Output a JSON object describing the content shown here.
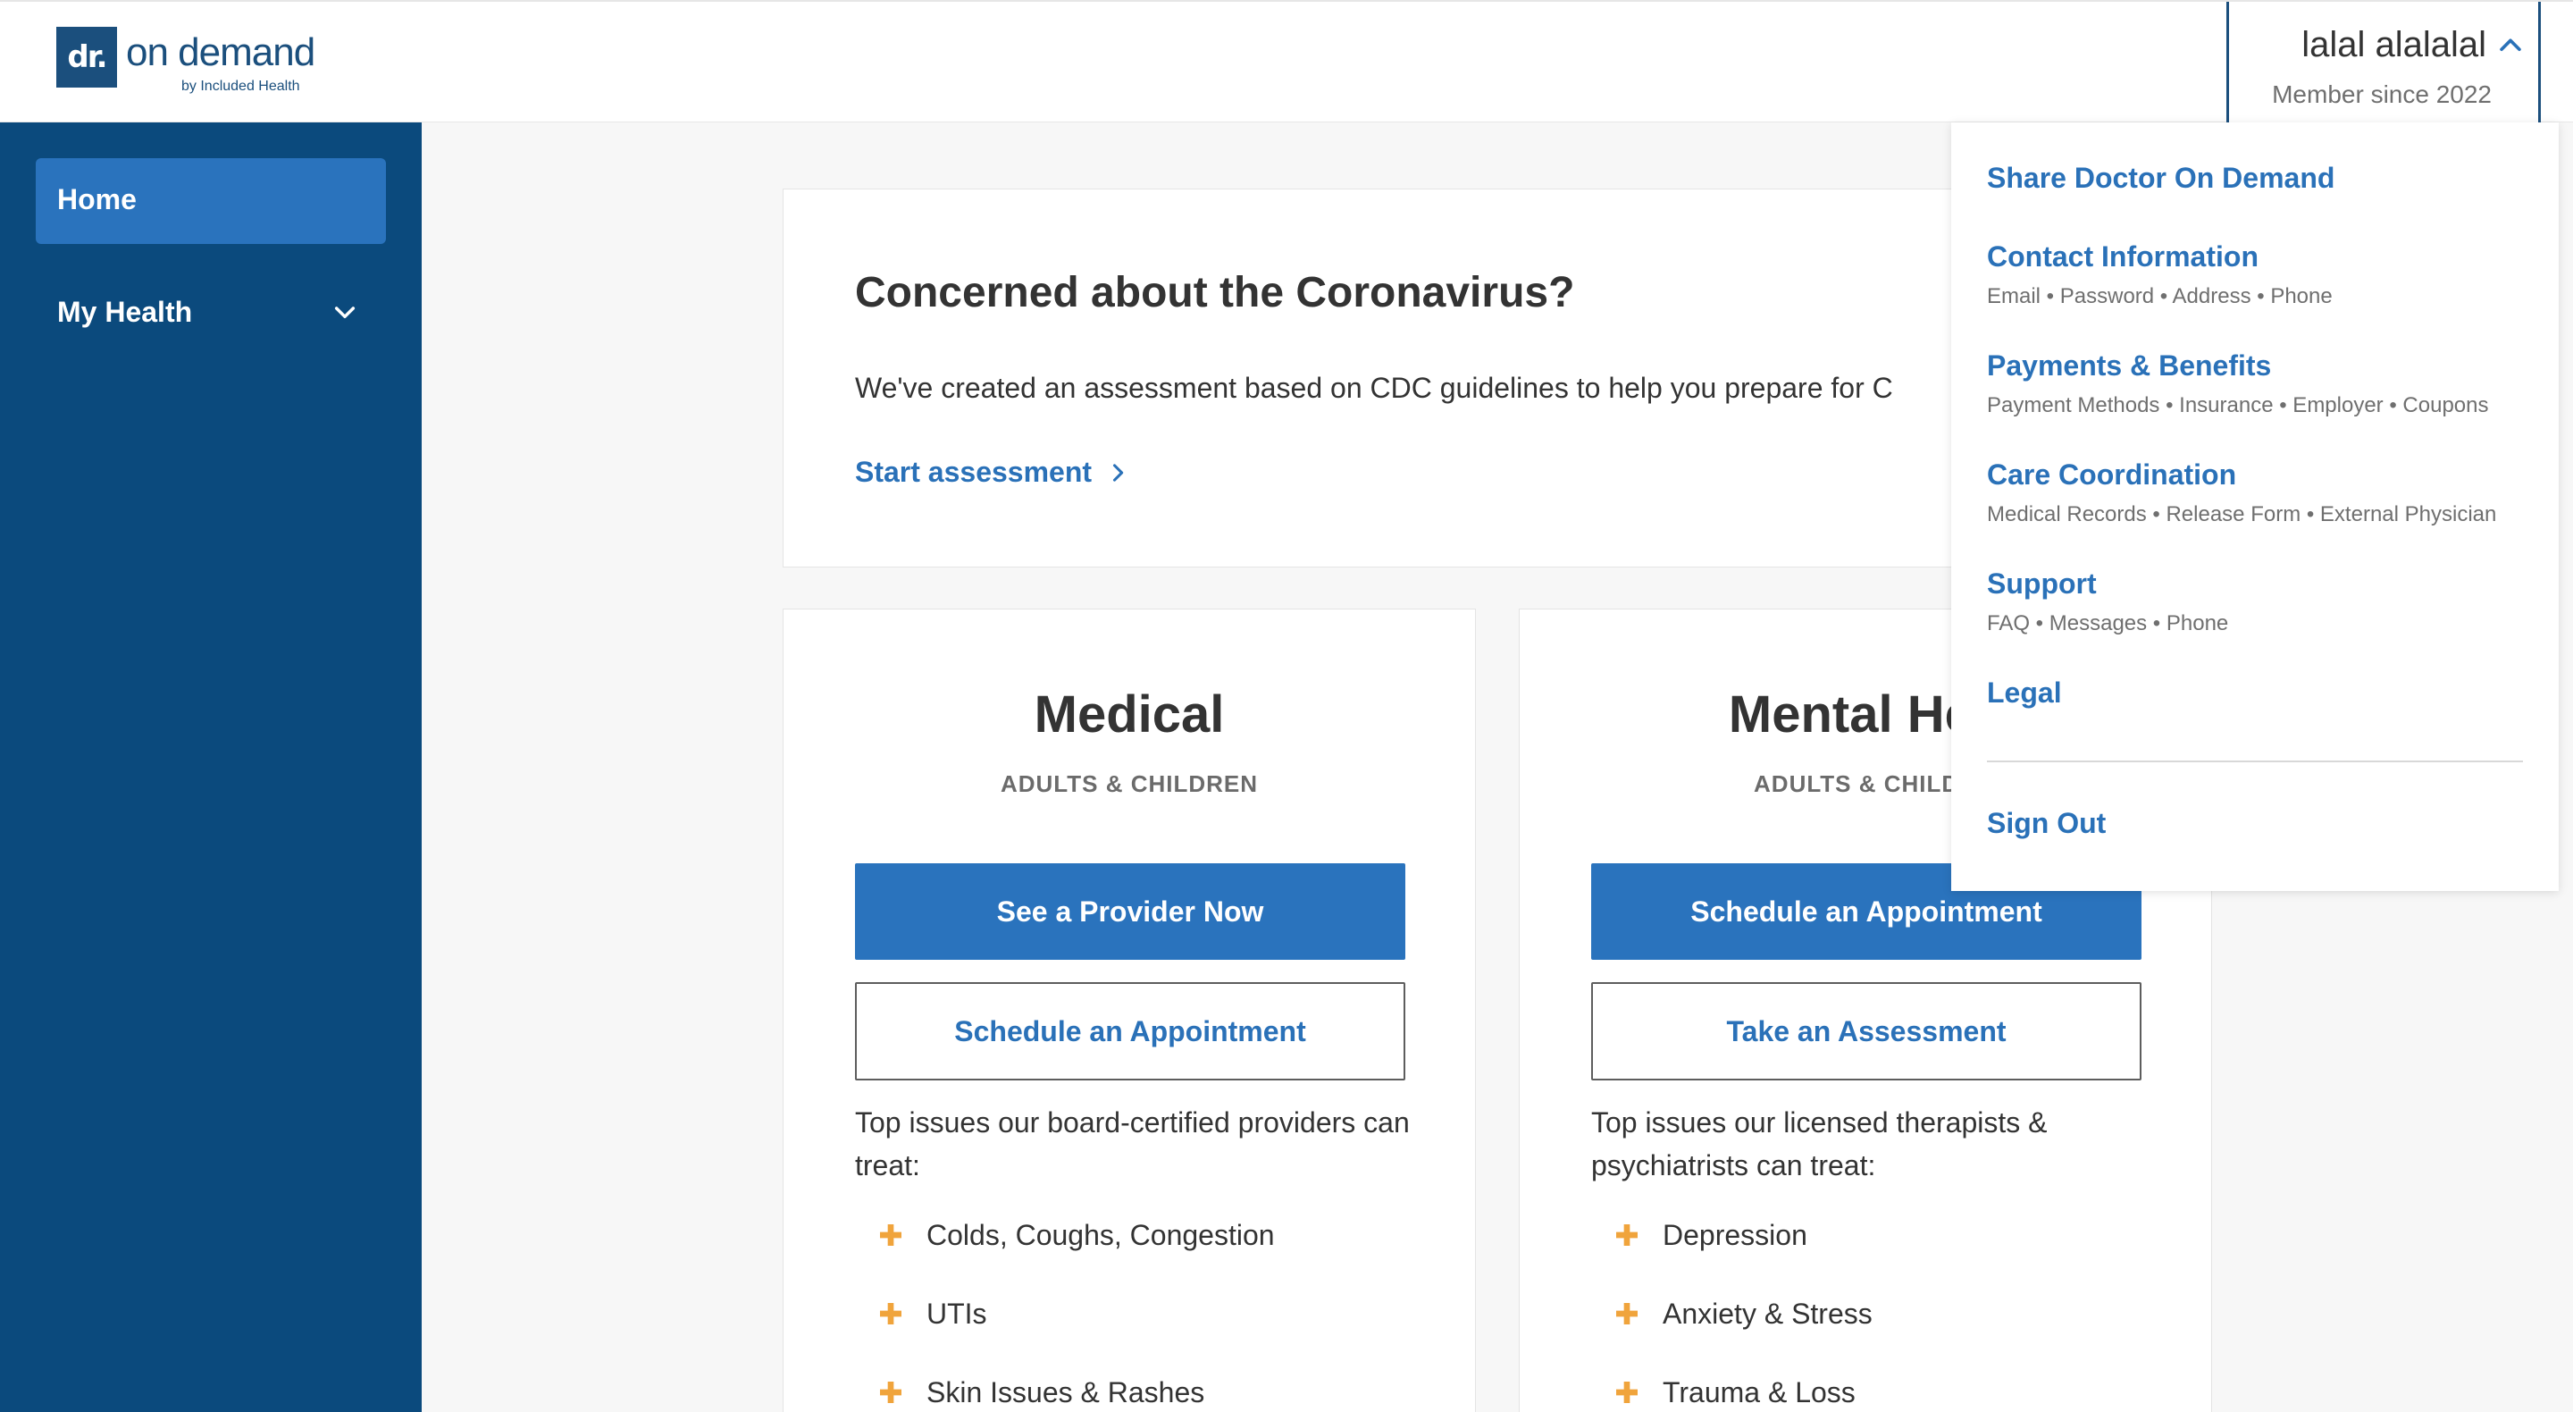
{
  "header": {
    "logo": {
      "mark": "dr.",
      "name": "on demand",
      "byline": "by Included Health"
    },
    "user": {
      "name": "lalal alalalal",
      "member_since": "Member since 2022"
    }
  },
  "sidebar": {
    "items": [
      {
        "label": "Home",
        "active": true
      },
      {
        "label": "My Health",
        "expandable": true
      }
    ]
  },
  "covid": {
    "title": "Concerned about the Coronavirus?",
    "body": "We've created an assessment based on CDC guidelines to help you prepare for C",
    "link": "Start assessment"
  },
  "services": [
    {
      "title": "Medical",
      "subtitle": "ADULTS & CHILDREN",
      "primary": "See a Provider Now",
      "secondary": "Schedule an Appointment",
      "description": "Top issues our board-certified providers can treat:",
      "issues": [
        "Colds, Coughs, Congestion",
        "UTIs",
        "Skin Issues & Rashes"
      ]
    },
    {
      "title": "Mental Hea",
      "subtitle": "ADULTS & CHILDR",
      "primary": "Schedule an Appointment",
      "secondary": "Take an Assessment",
      "description": "Top issues our licensed therapists & psychiatrists can treat:",
      "issues": [
        "Depression",
        "Anxiety & Stress",
        "Trauma & Loss"
      ]
    }
  ],
  "menu": {
    "items": [
      {
        "title": "Share Doctor On Demand",
        "meta": ""
      },
      {
        "title": "Contact Information",
        "meta": "Email • Password • Address • Phone"
      },
      {
        "title": "Payments & Benefits",
        "meta": "Payment Methods • Insurance • Employer • Coupons"
      },
      {
        "title": "Care Coordination",
        "meta": "Medical Records • Release Form • External Physician"
      },
      {
        "title": "Support",
        "meta": "FAQ • Messages • Phone"
      },
      {
        "title": "Legal",
        "meta": ""
      }
    ],
    "sign_out": "Sign Out"
  },
  "icons": {
    "user_menu": "chevron-up-icon",
    "my_health": "chevron-down-icon",
    "assessment_link": "chevron-right-icon",
    "issue_bullet": "plus-icon"
  },
  "colors": {
    "sidebar": "#0b4a7d",
    "nav_active": "#2a73bd",
    "link": "#2a71b8",
    "accent_plus": "#f0a43c",
    "logo": "#1b4f7d"
  }
}
